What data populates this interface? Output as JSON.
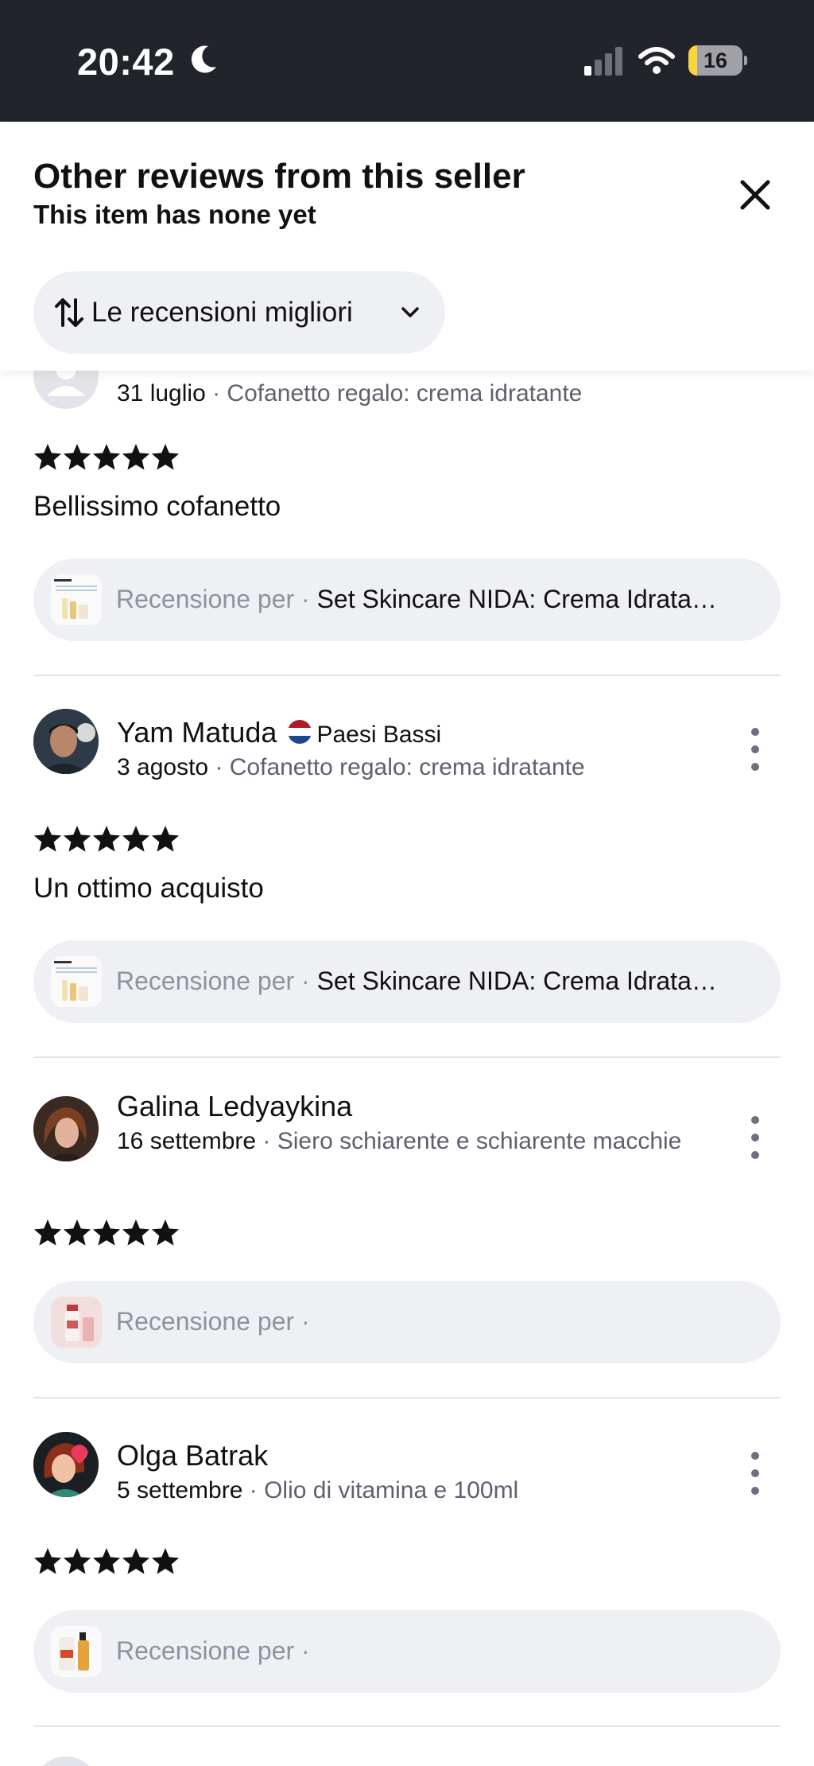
{
  "status_bar": {
    "time": "20:42",
    "battery": "16",
    "battery_level": 0.16
  },
  "header": {
    "title": "Other reviews from this seller",
    "subtitle": "This item has none yet",
    "sort_label": "Le recensioni migliori"
  },
  "reviews": [
    {
      "date": "31 luglio",
      "meta": " · Cofanetto regalo: crema idratante",
      "rating": 5,
      "text": "Bellissimo cofanetto",
      "review_prefix": "Recensione per · ",
      "product": "Set Skincare NIDA: Crema Idrata…"
    },
    {
      "name": "Yam Matuda",
      "country": "Paesi Bassi",
      "date": "3 agosto",
      "meta": " · Cofanetto regalo: crema idratante",
      "rating": 5,
      "text": "Un ottimo acquisto",
      "review_prefix": "Recensione per · ",
      "product": "Set Skincare NIDA: Crema Idrata…"
    },
    {
      "name": "Galina Ledyaykina",
      "date": "16 settembre",
      "meta": " · Siero schiarente e schiarente macchie",
      "rating": 5,
      "review_prefix": "Recensione per · "
    },
    {
      "name": "Olga Batrak",
      "date": "5 settembre",
      "meta": " · Olio di vitamina e 100ml",
      "rating": 5,
      "review_prefix": "Recensione per · "
    }
  ],
  "colors": {
    "status_bar": "#22242c",
    "pill": "#eff0f4",
    "muted": "#5e6070",
    "flag_red": "#ae1c28",
    "flag_blue": "#21468b",
    "battery_yellow": "#f6d63b"
  }
}
